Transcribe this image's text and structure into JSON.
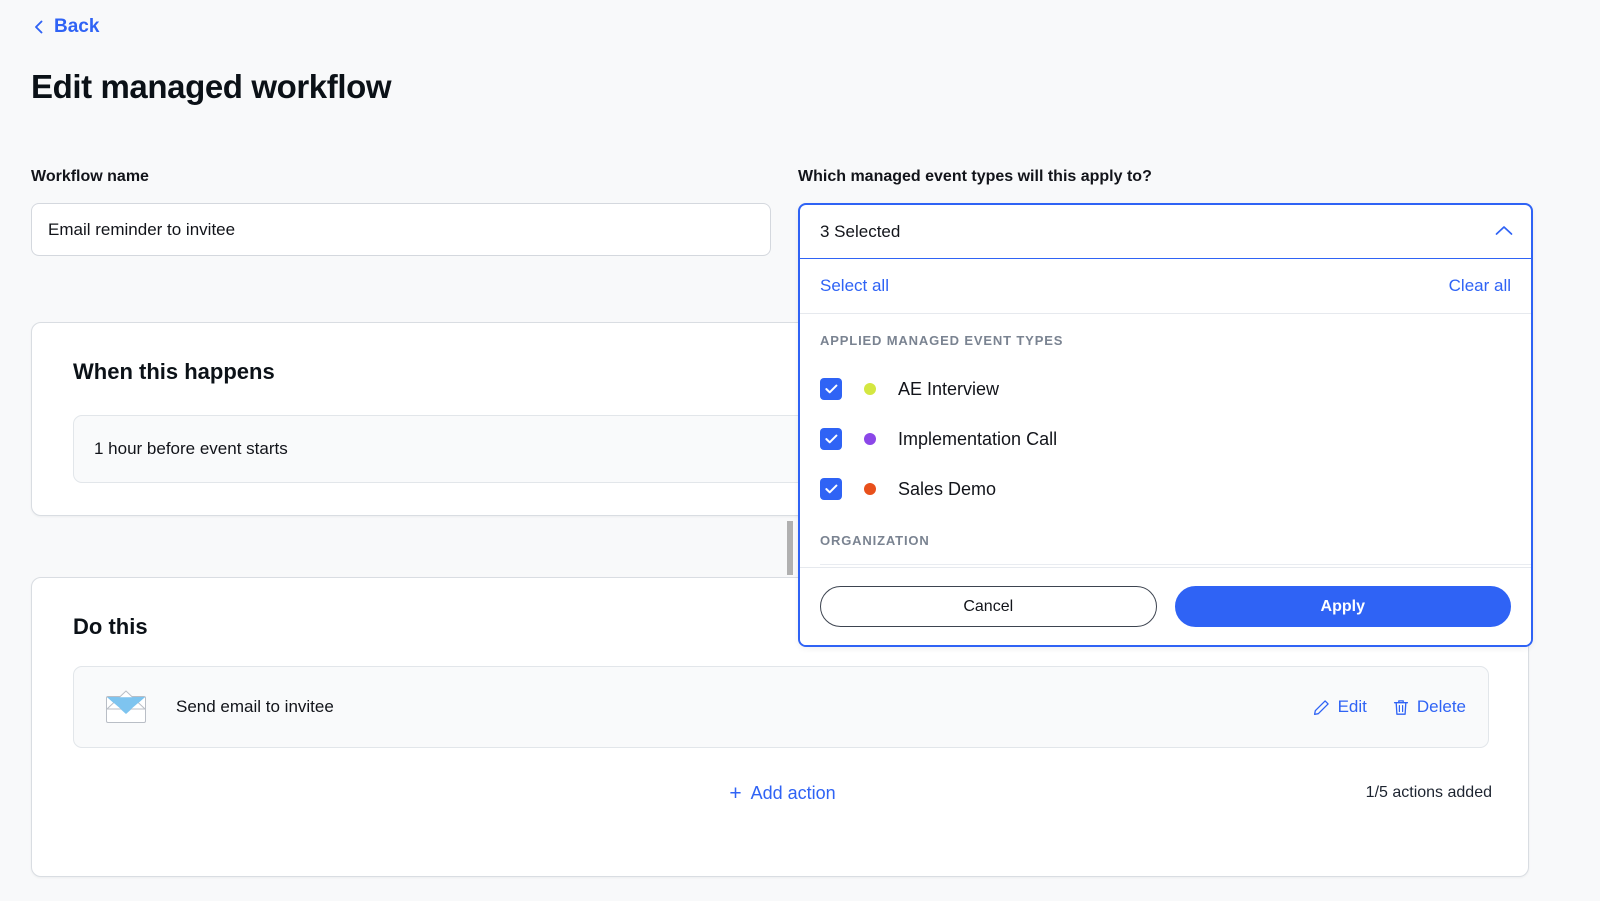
{
  "nav": {
    "back_label": "Back",
    "back_icon": "chevron-left-icon"
  },
  "header": {
    "title": "Edit managed workflow"
  },
  "workflow_name": {
    "label": "Workflow name",
    "value": "Email reminder to invitee",
    "placeholder": "Workflow name"
  },
  "when_card": {
    "title": "When this happens",
    "trigger_text": "1 hour before event starts"
  },
  "do_card": {
    "title": "Do this",
    "action_icon": "envelope-icon",
    "action_text": "Send email to invitee",
    "edit_label": "Edit",
    "edit_icon": "pencil-icon",
    "delete_label": "Delete",
    "delete_icon": "trash-icon",
    "add_action_label": "Add action",
    "add_action_icon": "plus-icon",
    "actions_count": "1/5 actions added"
  },
  "event_type_dropdown": {
    "label": "Which managed event types will this apply to?",
    "selected_text": "3 Selected",
    "caret_icon": "chevron-up-icon",
    "select_all_label": "Select all",
    "clear_all_label": "Clear all",
    "groups": [
      {
        "heading": "APPLIED MANAGED EVENT TYPES",
        "items": [
          {
            "label": "AE Interview",
            "checked": true,
            "color": "#d4e741"
          },
          {
            "label": "Implementation Call",
            "checked": true,
            "color": "#8b47e8"
          },
          {
            "label": "Sales Demo",
            "checked": true,
            "color": "#e8501b"
          }
        ]
      },
      {
        "heading": "ORGANIZATION",
        "items": [
          {
            "label": "",
            "checked": false,
            "color": "#c9ced6"
          }
        ]
      }
    ],
    "cancel_label": "Cancel",
    "apply_label": "Apply"
  },
  "colors": {
    "accent_blue": "#2f63f5",
    "page_bg": "#f8f9fa",
    "card_bg": "#ffffff",
    "text_primary": "#0b1117",
    "muted": "#7a8391"
  }
}
